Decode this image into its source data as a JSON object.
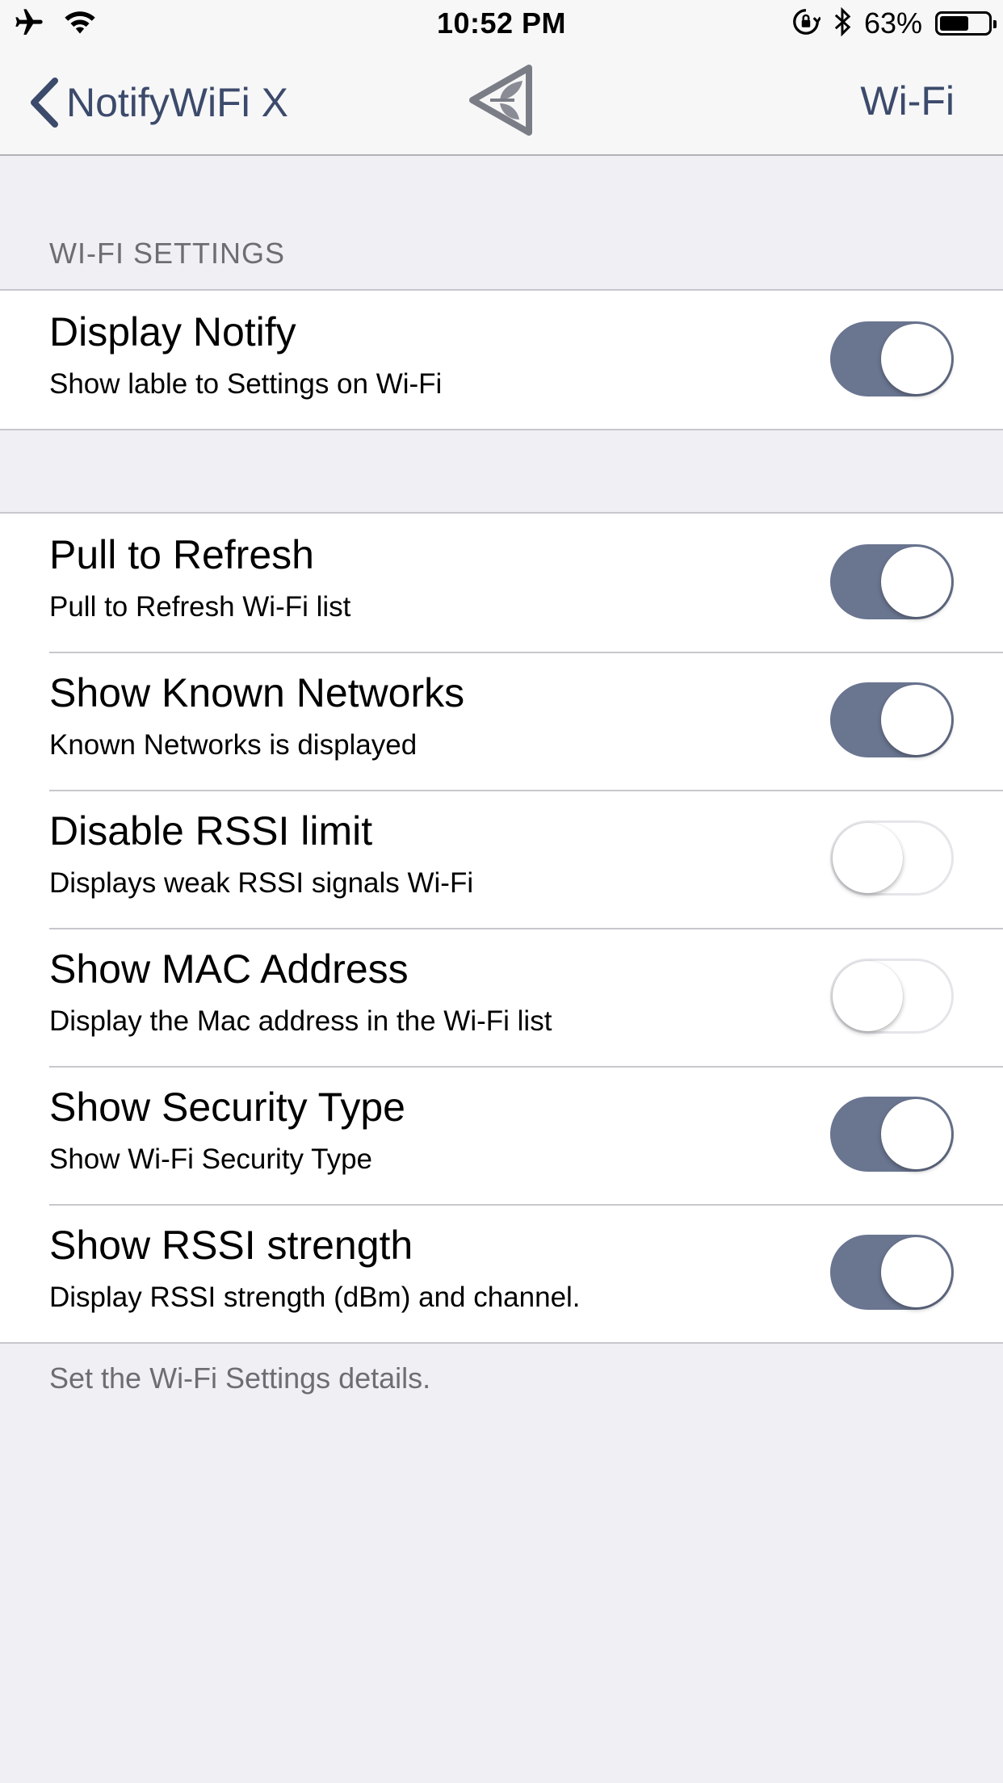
{
  "status_bar": {
    "time": "10:52 PM",
    "battery_percent": "63%",
    "battery_level": 0.63,
    "icons": [
      "airplane-icon",
      "wifi-icon",
      "orientation-lock-icon",
      "bluetooth-icon",
      "battery-icon"
    ]
  },
  "nav": {
    "back_label": "NotifyWiFi X",
    "right_label": "Wi-Fi",
    "logo_icon": "app-logo-icon"
  },
  "section": {
    "header": "WI-FI SETTINGS",
    "footer": "Set the Wi-Fi Settings details."
  },
  "groups": [
    {
      "items": [
        {
          "title": "Display Notify",
          "subtitle": "Show lable to Settings on Wi-Fi",
          "on": true
        }
      ]
    },
    {
      "items": [
        {
          "title": "Pull to Refresh",
          "subtitle": "Pull to Refresh Wi-Fi list",
          "on": true
        },
        {
          "title": "Show Known Networks",
          "subtitle": "Known Networks is displayed",
          "on": true
        },
        {
          "title": "Disable RSSI limit",
          "subtitle": "Displays weak RSSI signals Wi-Fi",
          "on": false
        },
        {
          "title": "Show MAC Address",
          "subtitle": "Display the Mac address in the Wi-Fi list",
          "on": false
        },
        {
          "title": "Show Security Type",
          "subtitle": "Show Wi-Fi Security Type",
          "on": true
        },
        {
          "title": "Show RSSI strength",
          "subtitle": "Display RSSI strength (dBm) and channel.",
          "on": true
        }
      ]
    }
  ],
  "colors": {
    "accent": "#3c4a6b",
    "toggle_on": "#6a7590",
    "background": "#efeff4"
  }
}
